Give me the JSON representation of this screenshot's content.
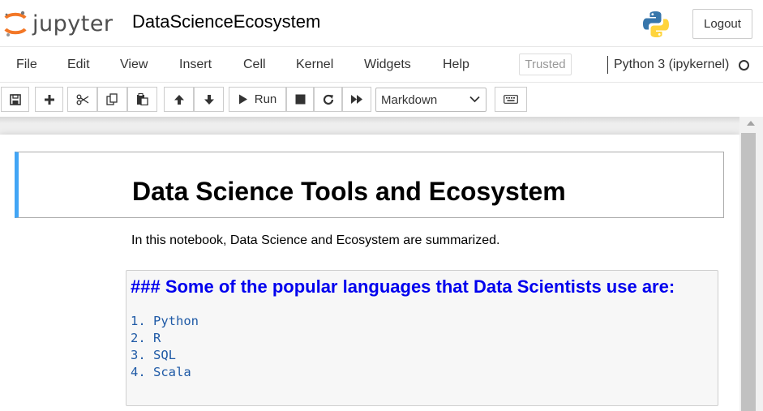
{
  "header": {
    "logo_text": "jupyter",
    "notebook_name": "DataScienceEcosystem",
    "logout_label": "Logout"
  },
  "menu": {
    "items": [
      {
        "label": "File"
      },
      {
        "label": "Edit"
      },
      {
        "label": "View"
      },
      {
        "label": "Insert"
      },
      {
        "label": "Cell"
      },
      {
        "label": "Kernel"
      },
      {
        "label": "Widgets"
      },
      {
        "label": "Help"
      }
    ],
    "trusted_label": "Trusted",
    "kernel_name": "Python 3 (ipykernel)"
  },
  "toolbar": {
    "run_label": "Run",
    "cell_type": "Markdown",
    "icons": [
      "save-icon",
      "plus-icon",
      "cut-icon",
      "copy-icon",
      "paste-icon",
      "arrow-up-icon",
      "arrow-down-icon",
      "play-icon",
      "stop-icon",
      "restart-icon",
      "fast-forward-icon",
      "keyboard-icon"
    ]
  },
  "notebook": {
    "cells": [
      {
        "type": "markdown-rendered",
        "text": "Data Science Tools and Ecosystem"
      },
      {
        "type": "markdown-rendered",
        "text": "In this notebook, Data Science and Ecosystem are summarized."
      },
      {
        "type": "markdown-edit",
        "heading": "### Some of the popular languages that Data Scientists use are:",
        "list": [
          "1. Python",
          "2. R",
          "3. SQL",
          "4. Scala"
        ]
      }
    ]
  },
  "colors": {
    "selected_cell_border": "#42a5f5",
    "heading_blue": "#0000ee",
    "code_blue": "#1f5aa6",
    "jupyter_orange": "#f37726"
  }
}
